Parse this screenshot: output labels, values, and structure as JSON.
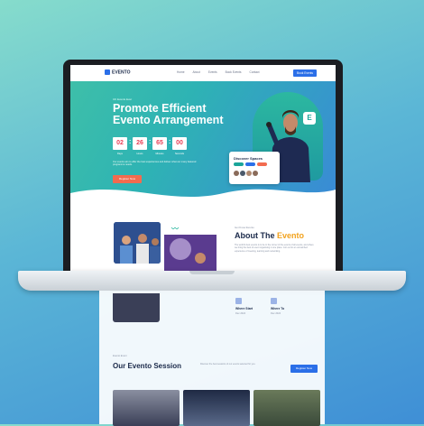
{
  "nav": {
    "logo": "EVENTO",
    "links": [
      "Home",
      "About",
      "Events",
      "Book Events",
      "Contact"
    ],
    "cta": "Book Events"
  },
  "hero": {
    "kicker": "UK Events Ever",
    "title": "Promote Efficient Evento Arrangement",
    "countdown": [
      {
        "value": "02",
        "label": "Days"
      },
      {
        "value": "26",
        "label": "Hours"
      },
      {
        "value": "65",
        "label": "Minutes"
      },
      {
        "value": "00",
        "label": "Seconds"
      }
    ],
    "description": "Our events aim to offer the best experiences and deliver what our many featured programme needs.",
    "register_label": "Register Now",
    "badge_letter": "E",
    "discover": {
      "title": "Discover Spaces"
    }
  },
  "about": {
    "kicker": "Get Know Evento",
    "heading_plain": "About The",
    "heading_accent": "Evento",
    "paragraph": "The world's best evento is to be in the corner of the events of all events, and where we bring the best of event organising in one place. Join us for an unmatched experience of meeting, learning and networking.",
    "where": {
      "title": "Where Start",
      "text": "Dec 2024"
    },
    "where_to": {
      "title": "Where To",
      "text": "Dec 2024"
    }
  },
  "session": {
    "kicker": "Evento Event",
    "heading": "Our Evento Session",
    "paragraph": "Discover the best sessions of our events selected for you.",
    "cta": "Register Now"
  },
  "colors": {
    "accent": "#2b6fe8",
    "teal": "#2cb8a0",
    "orange": "#f26b4f",
    "countdown_text": "#e8435a"
  }
}
